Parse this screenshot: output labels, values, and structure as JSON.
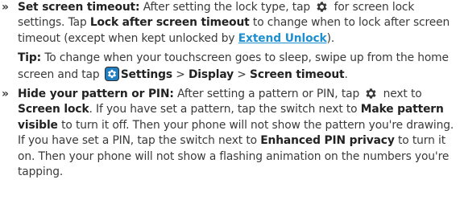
{
  "item1": {
    "title": "Set screen timeout:",
    "t1": " After setting the lock type, tap ",
    "icon1": "gear-icon",
    "t2": " for screen lock settings. Tap ",
    "bold1": "Lock after screen timeout",
    "t3": " to change when to lock after screen timeout (except when kept unlocked by ",
    "link": "Extend Unlock",
    "t4": ")."
  },
  "tip": {
    "label": "Tip:",
    "t1": " To change when your touchscreen goes to sleep, swipe up from the home screen and tap ",
    "icon": "settings-app-icon",
    "settings": "Settings",
    "sep1": " > ",
    "display": "Display",
    "sep2": " > ",
    "timeout": "Screen timeout",
    "end": "."
  },
  "item2": {
    "title": "Hide your pattern or PIN:",
    "t1": " After setting a pattern or PIN, tap ",
    "icon1": "gear-icon",
    "t2": " next to ",
    "bold1": "Screen lock",
    "t3": ". If you have set a pattern, tap the switch next to ",
    "bold2": "Make pattern visible",
    "t4": " to turn it off. Then your phone will not show the pattern you're drawing. If you have set a PIN, tap the switch next to ",
    "bold3": "Enhanced PIN privacy",
    "t5": " to turn it on. Then your phone will not show a flashing animation on the numbers you're tapping."
  },
  "bullet_glyph": "»",
  "colors": {
    "text": "#3a3a3a",
    "link": "#1f8fd0",
    "settings_icon": "#1f7fc4"
  }
}
